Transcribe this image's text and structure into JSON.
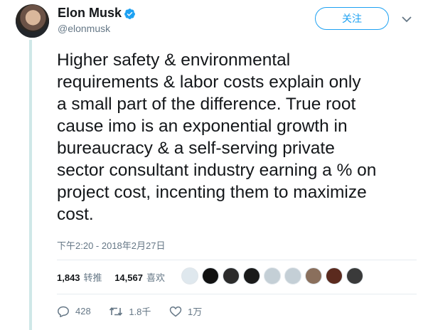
{
  "author": {
    "name": "Elon Musk",
    "handle": "@elonmusk",
    "verified": true,
    "follow_label": "关注"
  },
  "tweet": {
    "text": "Higher safety & environmental\nrequirements & labor costs explain only\na small part of the difference. True root\ncause imo is an exponential growth in\nbureaucracy & a self-serving private\nsector consultant industry earning a % on\nproject cost, incenting them to maximize\ncost.",
    "timestamp": "下午2:20 - 2018年2月27日"
  },
  "stats": {
    "retweets_count": "1,843",
    "retweets_label": "转推",
    "likes_count": "14,567",
    "likes_label": "喜欢"
  },
  "liker_avatars": [
    {
      "name": "liker-avatar-1",
      "color": "#dfe8ee"
    },
    {
      "name": "liker-avatar-2",
      "color": "#111111"
    },
    {
      "name": "liker-avatar-3",
      "color": "#2b2b2b"
    },
    {
      "name": "liker-avatar-4",
      "color": "#1a1a1a"
    },
    {
      "name": "liker-avatar-5",
      "color": "#c4cfd6"
    },
    {
      "name": "liker-avatar-6",
      "color": "#c4cfd6"
    },
    {
      "name": "liker-avatar-7",
      "color": "#8a6f5c"
    },
    {
      "name": "liker-avatar-8",
      "color": "#5b2a1e"
    },
    {
      "name": "liker-avatar-9",
      "color": "#3a3a3a"
    }
  ],
  "actions": {
    "replies": "428",
    "retweets": "1.8千",
    "likes": "1万"
  },
  "colors": {
    "accent": "#1da1f2",
    "muted": "#657786",
    "thread_line": "#cfe8e8"
  },
  "icons": {
    "verified": "verified-badge-icon",
    "caret": "chevron-down-icon",
    "reply": "reply-icon",
    "retweet": "retweet-icon",
    "like": "heart-icon"
  }
}
